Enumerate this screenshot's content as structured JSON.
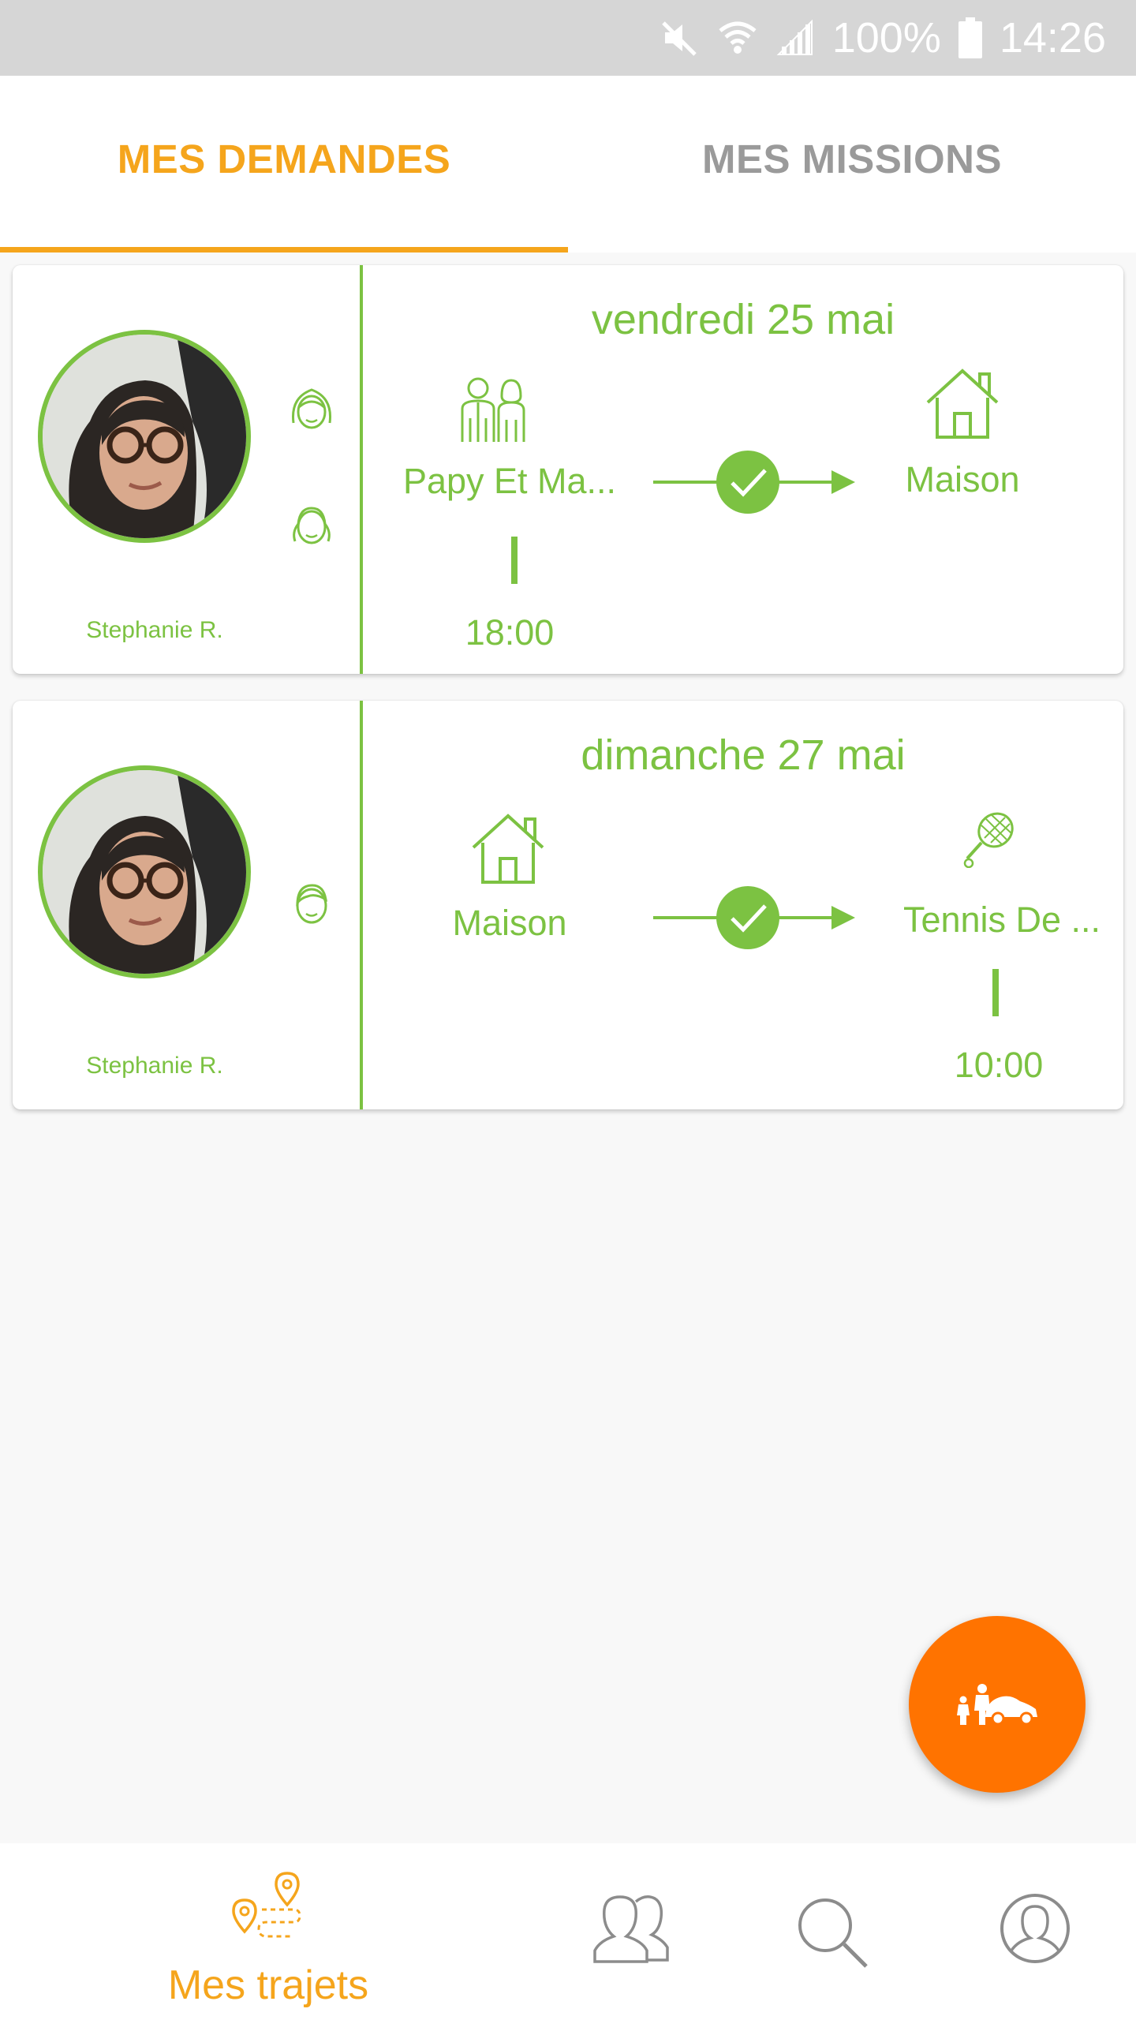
{
  "status_bar": {
    "battery": "100%",
    "time": "14:26",
    "icons": [
      "mute-icon",
      "wifi-icon",
      "signal-icon",
      "battery-icon"
    ]
  },
  "tabs": [
    {
      "label": "MES DEMANDES",
      "active": true
    },
    {
      "label": "MES MISSIONS",
      "active": false
    }
  ],
  "trips": [
    {
      "driver_name": "Stephanie R.",
      "date": "vendredi 25 mai",
      "passengers": [
        "girl-icon",
        "girl-icon"
      ],
      "from": {
        "label": "Papy Et Ma...",
        "icon": "grandparents-icon"
      },
      "to": {
        "label": "Maison",
        "icon": "house-icon"
      },
      "time": "18:00",
      "status": "confirmed"
    },
    {
      "driver_name": "Stephanie R.",
      "date": "dimanche 27 mai",
      "passengers": [
        "boy-icon"
      ],
      "from": {
        "label": "Maison",
        "icon": "house-icon"
      },
      "to": {
        "label": "Tennis De ...",
        "icon": "tennis-racket-icon"
      },
      "time": "10:00",
      "status": "confirmed"
    }
  ],
  "fab": {
    "icon": "family-car-icon"
  },
  "bottom_nav": [
    {
      "label": "Mes trajets",
      "icon": "route-pin-icon",
      "active": true
    },
    {
      "label": "",
      "icon": "people-icon",
      "active": false
    },
    {
      "label": "",
      "icon": "search-icon",
      "active": false
    },
    {
      "label": "",
      "icon": "profile-icon",
      "active": false
    }
  ],
  "colors": {
    "accent_green": "#7cc242",
    "accent_orange": "#f5a51c",
    "fab_orange": "#ff7300",
    "inactive_gray": "#9a9a9a"
  }
}
